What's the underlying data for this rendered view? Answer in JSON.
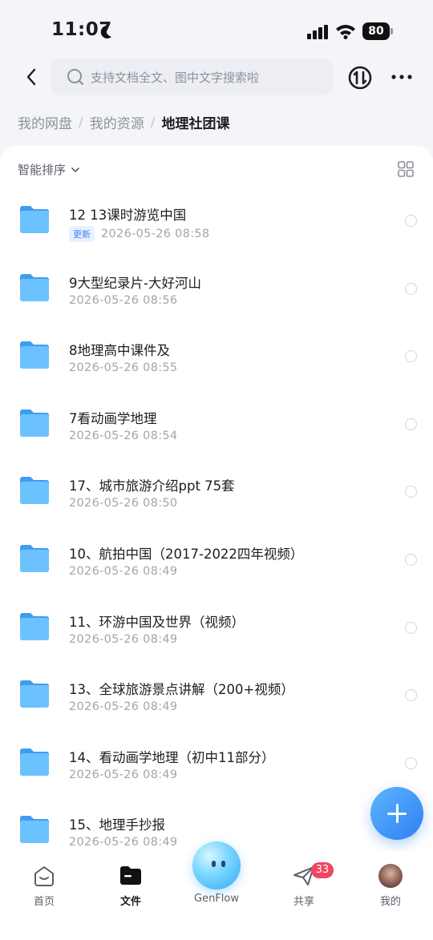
{
  "status_bar": {
    "time": "11:07",
    "battery": "80"
  },
  "header": {
    "search_placeholder": "支持文档全文、图中文字搜索啦"
  },
  "breadcrumb": {
    "items": [
      "我的网盘",
      "我的资源"
    ],
    "separator": "/",
    "current": "地理社团课"
  },
  "toolbar": {
    "sort_label": "智能排序"
  },
  "files": [
    {
      "name": "12 13课时游览中国",
      "badge": "更新",
      "date": "2026-05-26 08:58"
    },
    {
      "name": "9大型纪录片-大好河山",
      "date": "2026-05-26 08:56"
    },
    {
      "name": "8地理高中课件及",
      "date": "2026-05-26 08:55"
    },
    {
      "name": "7看动画学地理",
      "date": "2026-05-26 08:54"
    },
    {
      "name": "17、城市旅游介绍ppt 75套",
      "date": "2026-05-26 08:50"
    },
    {
      "name": "10、航拍中国（2017-2022四年视频）",
      "date": "2026-05-26 08:49"
    },
    {
      "name": "11、环游中国及世界（视频）",
      "date": "2026-05-26 08:49"
    },
    {
      "name": "13、全球旅游景点讲解（200+视频）",
      "date": "2026-05-26 08:49"
    },
    {
      "name": "14、看动画学地理（初中11部分）",
      "date": "2026-05-26 08:49"
    },
    {
      "name": "15、地理手抄报",
      "date": "2026-05-26 08:49"
    }
  ],
  "tabs": {
    "home": "首页",
    "files": "文件",
    "genflow": "GenFlow",
    "share": "共享",
    "share_badge": "33",
    "me": "我的"
  },
  "colors": {
    "accent": "#2f7ff0",
    "folder": "#5cb6ff",
    "badge_red": "#f2455f"
  },
  "icons": [
    "back-icon",
    "search-icon",
    "transfer-icon",
    "more-icon",
    "chevron-down-icon",
    "grid-icon",
    "folder-icon",
    "plus-icon",
    "home-icon",
    "files-icon",
    "share-icon"
  ]
}
